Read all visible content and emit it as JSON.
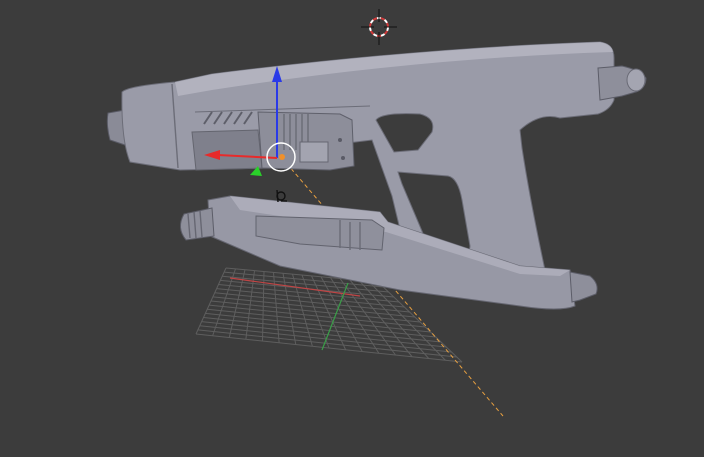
{
  "viewport": {
    "background": "#3c3c3c",
    "mode": "3D Viewport",
    "shading": "solid"
  },
  "colors": {
    "model_body": "#9a9ba8",
    "model_shadow": "#6c6d78",
    "model_highlight": "#b9bac6",
    "grid_line": "#5e5e5e",
    "axis_x": "#d04a4a",
    "axis_y": "#3aa84a",
    "gizmo_x": "#e82a2a",
    "gizmo_y": "#2ad12a",
    "gizmo_z": "#2a3ae8",
    "selection_origin": "#f0902a",
    "cursor_ring_red": "#d23a3a",
    "cursor_ring_white": "#ffffff",
    "light_ray": "#e8a040"
  },
  "objects": {
    "model": "blaster-pistol-mesh",
    "grid": "ground-grid",
    "cursor": "3d-cursor",
    "gizmo": "translate-gizmo",
    "lamp": "lamp-icon"
  }
}
